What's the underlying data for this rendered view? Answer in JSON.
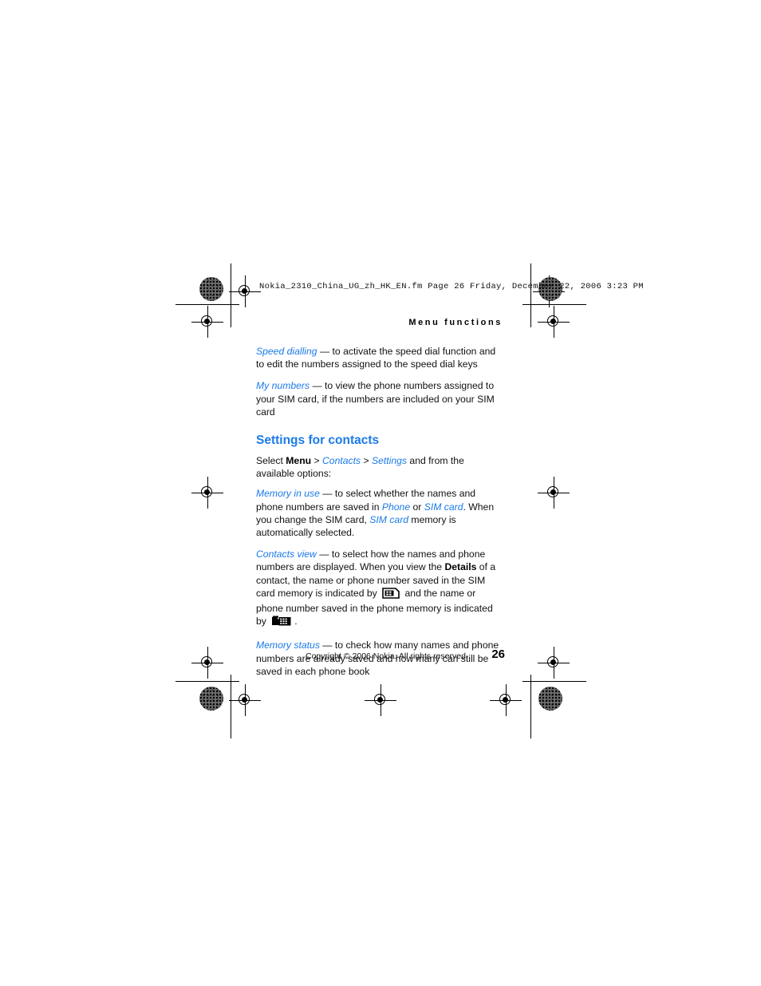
{
  "document": {
    "filename_bar": "Nokia_2310_China_UG_zh_HK_EN.fm  Page 26  Friday, December 22, 2006  3:23 PM",
    "running_header": "Menu functions",
    "footer_copyright": "Copyright © 2006 Nokia. All rights reserved.",
    "page_number": "26"
  },
  "colors": {
    "accent_blue": "#1a7ae8",
    "body_text": "#111111"
  },
  "body": {
    "speed_dialling": {
      "term": "Speed dialling",
      "dash": " — ",
      "text": "to activate the speed dial function and to edit the numbers assigned to the speed dial keys"
    },
    "my_numbers": {
      "term": "My numbers",
      "dash": " — ",
      "text": "to view the phone numbers assigned to your SIM card, if the numbers are included on your SIM card"
    },
    "section_heading": "Settings for contacts",
    "select_line": {
      "prefix": "Select ",
      "menu": "Menu",
      "sep1": " > ",
      "contacts": "Contacts",
      "sep2": " > ",
      "settings": "Settings",
      "suffix": " and from the available options:"
    },
    "memory_in_use": {
      "term": "Memory in use",
      "dash": " — ",
      "text_1": "to select whether the names and phone numbers are saved in ",
      "phone": "Phone",
      "text_2": " or ",
      "sim_card_1": "SIM card",
      "text_3": ". When you change the SIM card, ",
      "sim_card_2": "SIM card",
      "text_4": " memory is automatically selected."
    },
    "contacts_view": {
      "term": "Contacts view",
      "dash": " — ",
      "text_1": "to select how the names and phone numbers are displayed. When you view the ",
      "details": "Details",
      "text_2": " of a contact, the name or phone number saved in the SIM card memory is indicated by",
      "text_3": "and the name or phone number saved in the phone memory is indicated by",
      "text_4": ".",
      "icon_sim": "sim-card-icon",
      "icon_phone": "mobile-phone-icon"
    },
    "memory_status": {
      "term": "Memory status",
      "dash": " — ",
      "text": "to check how many names and phone numbers are already saved and how many can still be saved in each phone book"
    }
  }
}
